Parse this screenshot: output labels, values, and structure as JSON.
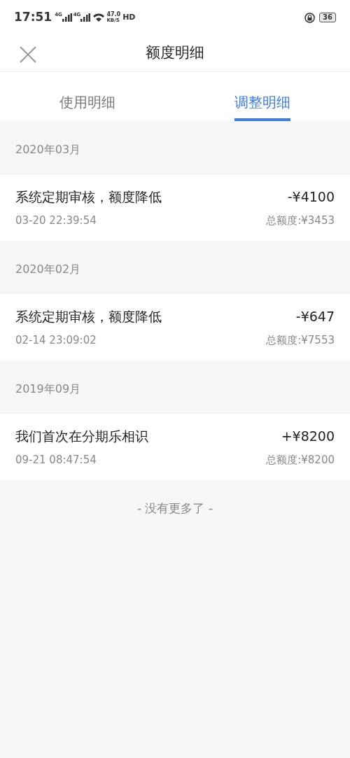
{
  "status_bar": {
    "time": "17:51",
    "network_1": "4G",
    "network_2": "4G",
    "speed_value": "47.0",
    "speed_unit": "KB/S",
    "hd": "HD",
    "battery": "36"
  },
  "header": {
    "title": "额度明细"
  },
  "tabs": [
    {
      "label": "使用明细",
      "selected": false
    },
    {
      "label": "调整明细",
      "selected": true
    }
  ],
  "groups": [
    {
      "month": "2020年03月",
      "entries": [
        {
          "description": "系统定期审核，额度降低",
          "time": "03-20 22:39:54",
          "amount": "-¥4100",
          "total": "总额度:¥3453"
        }
      ]
    },
    {
      "month": "2020年02月",
      "entries": [
        {
          "description": "系统定期审核，额度降低",
          "time": "02-14 23:09:02",
          "amount": "-¥647",
          "total": "总额度:¥7553"
        }
      ]
    },
    {
      "month": "2019年09月",
      "entries": [
        {
          "description": "我们首次在分期乐相识",
          "time": "09-21 08:47:54",
          "amount": "+¥8200",
          "total": "总额度:¥8200"
        }
      ]
    }
  ],
  "footer": "- 没有更多了 -"
}
